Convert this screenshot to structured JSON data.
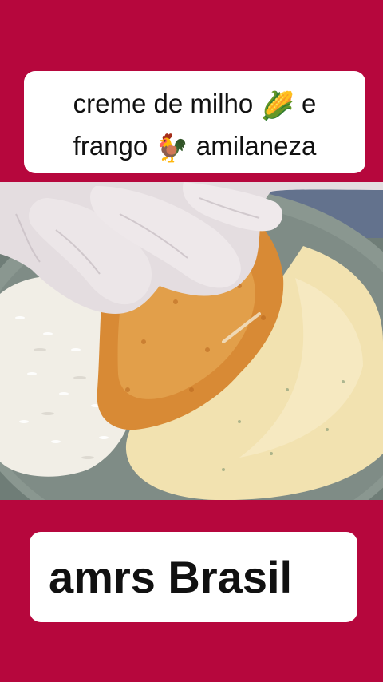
{
  "colors": {
    "background": "#b6073d",
    "card": "#ffffff",
    "text": "#111111",
    "plate": "#8a9790",
    "rice": "#f3f1ea",
    "chicken": "#d98d3a",
    "sauce": "#f2e2b0",
    "glove": "#e6dfe2"
  },
  "title": {
    "line1_text": "creme de milho",
    "line1_emoji": "🌽",
    "line1_suffix": "e",
    "line2_text": "frango",
    "line2_emoji": "🐓",
    "line2_suffix": "amilaneza"
  },
  "photo": {
    "icons": [
      "gloved-hand",
      "breaded-chicken-cutlet",
      "white-rice",
      "corn-cream-sauce",
      "plate"
    ]
  },
  "brand": {
    "text": "amrs Brasil"
  }
}
